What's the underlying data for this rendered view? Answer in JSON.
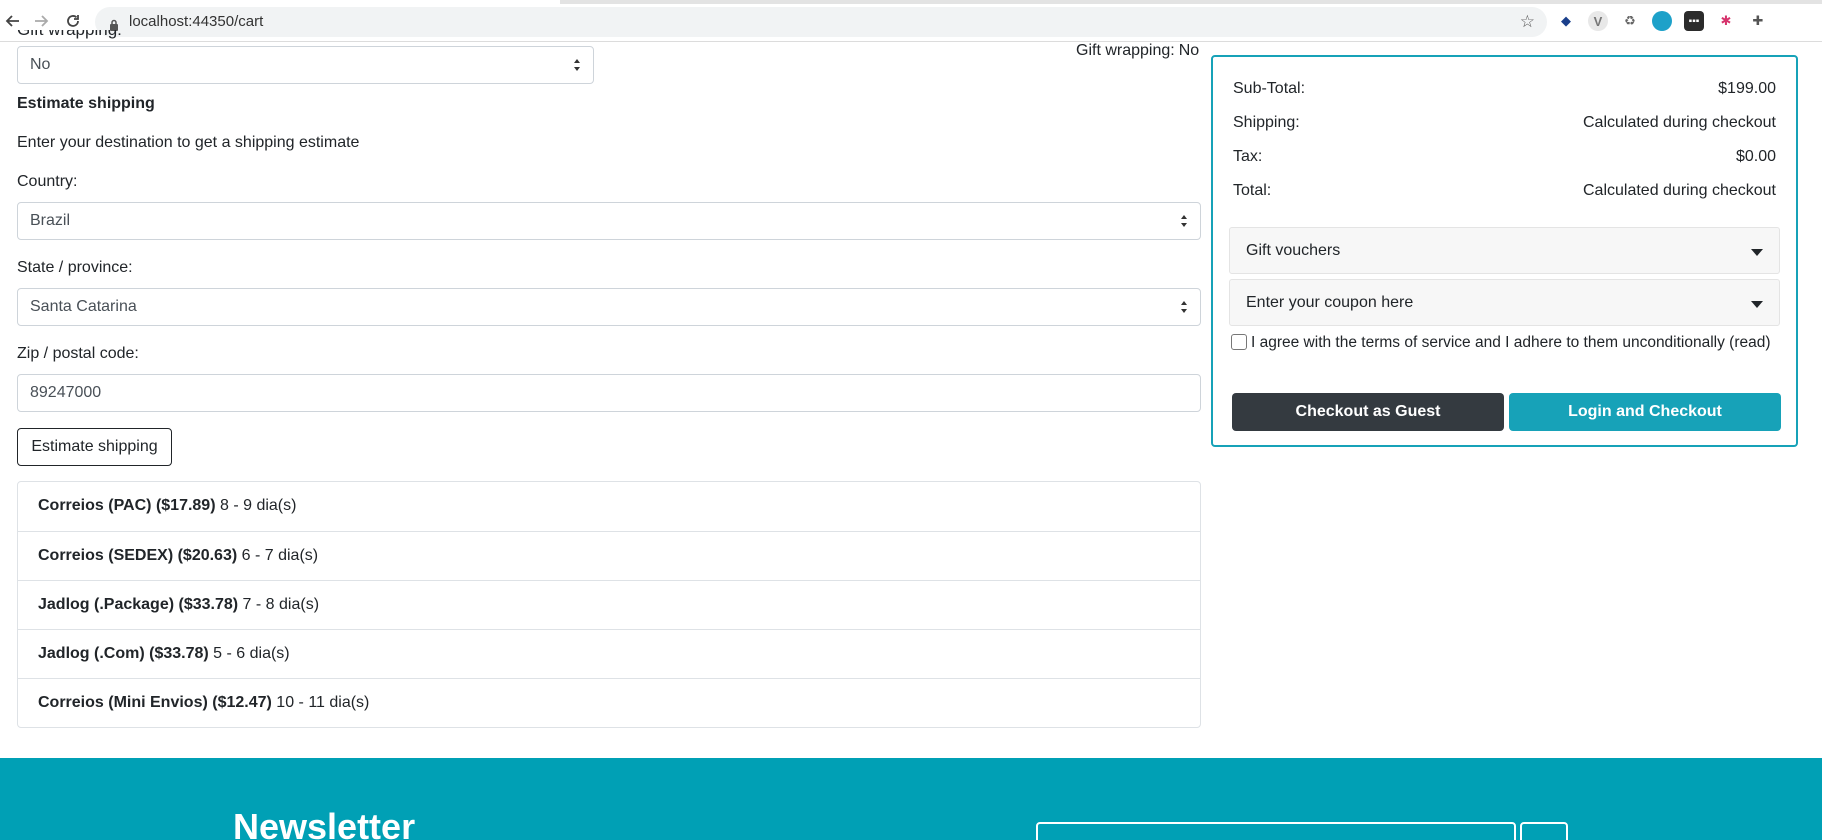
{
  "browser": {
    "url": "localhost:44350/cart"
  },
  "left": {
    "gift_wrap_cut_label": "Gift wrapping:",
    "gift_wrap_value": "No",
    "estimate_heading": "Estimate shipping",
    "estimate_intro": "Enter your destination to get a shipping estimate",
    "country_label": "Country:",
    "country_value": "Brazil",
    "state_label": "State / province:",
    "state_value": "Santa Catarina",
    "zip_label": "Zip / postal code:",
    "zip_value": "89247000",
    "estimate_button": "Estimate shipping",
    "shipping_options": [
      {
        "name": "Correios (PAC) ($17.89)",
        "eta": "8 - 9 dia(s)"
      },
      {
        "name": "Correios (SEDEX) ($20.63)",
        "eta": "6 - 7 dia(s)"
      },
      {
        "name": "Jadlog (.Package) ($33.78)",
        "eta": "7 - 8 dia(s)"
      },
      {
        "name": "Jadlog (.Com) ($33.78)",
        "eta": "5 - 6 dia(s)"
      },
      {
        "name": "Correios (Mini Envios) ($12.47)",
        "eta": "10 - 11 dia(s)"
      }
    ]
  },
  "right": {
    "gift_wrapping_label": "Gift wrapping:",
    "gift_wrapping_value": "No",
    "totals": {
      "subtotal_label": "Sub-Total:",
      "subtotal_value": "$199.00",
      "shipping_label": "Shipping:",
      "shipping_value": "Calculated during checkout",
      "tax_label": "Tax:",
      "tax_value": "$0.00",
      "total_label": "Total:",
      "total_value": "Calculated during checkout"
    },
    "gift_vouchers": "Gift vouchers",
    "coupon": "Enter your coupon here",
    "terms_text": "I agree with the terms of service and I adhere to them unconditionally (read)",
    "checkout_guest": "Checkout as Guest",
    "login_checkout": "Login and Checkout"
  },
  "footer": {
    "newsletter_title": "Newsletter"
  },
  "colors": {
    "accent": "#17a2b8",
    "footer_bg": "#00a0b5",
    "dark_button": "#343a40"
  }
}
